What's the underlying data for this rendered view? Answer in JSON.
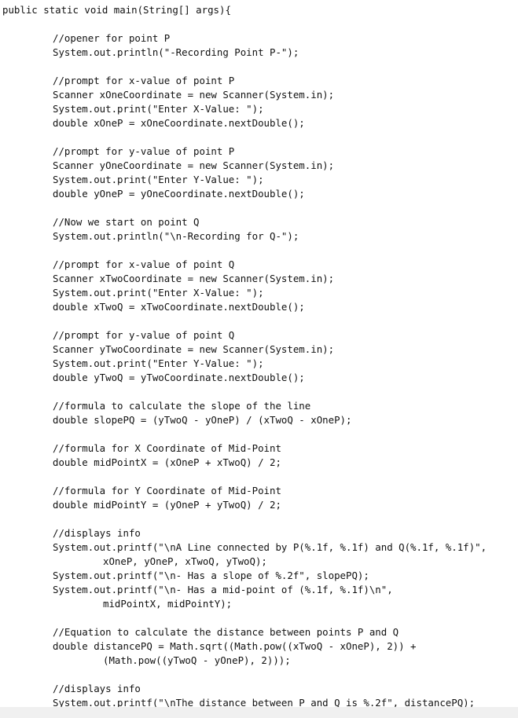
{
  "code": {
    "lines": [
      {
        "indent": 0,
        "text": "public static void main(String[] args){"
      },
      {
        "indent": 0,
        "text": ""
      },
      {
        "indent": 1,
        "text": "//opener for point P"
      },
      {
        "indent": 1,
        "text": "System.out.println(\"-Recording Point P-\");"
      },
      {
        "indent": 0,
        "text": ""
      },
      {
        "indent": 1,
        "text": "//prompt for x-value of point P"
      },
      {
        "indent": 1,
        "text": "Scanner xOneCoordinate = new Scanner(System.in);"
      },
      {
        "indent": 1,
        "text": "System.out.print(\"Enter X-Value: \");"
      },
      {
        "indent": 1,
        "text": "double xOneP = xOneCoordinate.nextDouble();"
      },
      {
        "indent": 0,
        "text": ""
      },
      {
        "indent": 1,
        "text": "//prompt for y-value of point P"
      },
      {
        "indent": 1,
        "text": "Scanner yOneCoordinate = new Scanner(System.in);"
      },
      {
        "indent": 1,
        "text": "System.out.print(\"Enter Y-Value: \");"
      },
      {
        "indent": 1,
        "text": "double yOneP = yOneCoordinate.nextDouble();"
      },
      {
        "indent": 0,
        "text": ""
      },
      {
        "indent": 1,
        "text": "//Now we start on point Q"
      },
      {
        "indent": 1,
        "text": "System.out.println(\"\\n-Recording for Q-\");"
      },
      {
        "indent": 0,
        "text": ""
      },
      {
        "indent": 1,
        "text": "//prompt for x-value of point Q"
      },
      {
        "indent": 1,
        "text": "Scanner xTwoCoordinate = new Scanner(System.in);"
      },
      {
        "indent": 1,
        "text": "System.out.print(\"Enter X-Value: \");"
      },
      {
        "indent": 1,
        "text": "double xTwoQ = xTwoCoordinate.nextDouble();"
      },
      {
        "indent": 0,
        "text": ""
      },
      {
        "indent": 1,
        "text": "//prompt for y-value of point Q"
      },
      {
        "indent": 1,
        "text": "Scanner yTwoCoordinate = new Scanner(System.in);"
      },
      {
        "indent": 1,
        "text": "System.out.print(\"Enter Y-Value: \");"
      },
      {
        "indent": 1,
        "text": "double yTwoQ = yTwoCoordinate.nextDouble();"
      },
      {
        "indent": 0,
        "text": ""
      },
      {
        "indent": 1,
        "text": "//formula to calculate the slope of the line"
      },
      {
        "indent": 1,
        "text": "double slopePQ = (yTwoQ - yOneP) / (xTwoQ - xOneP);"
      },
      {
        "indent": 0,
        "text": ""
      },
      {
        "indent": 1,
        "text": "//formula for X Coordinate of Mid-Point"
      },
      {
        "indent": 1,
        "text": "double midPointX = (xOneP + xTwoQ) / 2;"
      },
      {
        "indent": 0,
        "text": ""
      },
      {
        "indent": 1,
        "text": "//formula for Y Coordinate of Mid-Point"
      },
      {
        "indent": 1,
        "text": "double midPointY = (yOneP + yTwoQ) / 2;"
      },
      {
        "indent": 0,
        "text": ""
      },
      {
        "indent": 1,
        "text": "//displays info"
      },
      {
        "indent": 1,
        "text": "System.out.printf(\"\\nA Line connected by P(%.1f, %.1f) and Q(%.1f, %.1f)\","
      },
      {
        "indent": 2,
        "text": "xOneP, yOneP, xTwoQ, yTwoQ);"
      },
      {
        "indent": 1,
        "text": "System.out.printf(\"\\n- Has a slope of %.2f\", slopePQ);"
      },
      {
        "indent": 1,
        "text": "System.out.printf(\"\\n- Has a mid-point of (%.1f, %.1f)\\n\","
      },
      {
        "indent": 2,
        "text": "midPointX, midPointY);"
      },
      {
        "indent": 0,
        "text": ""
      },
      {
        "indent": 1,
        "text": "//Equation to calculate the distance between points P and Q"
      },
      {
        "indent": 1,
        "text": "double distancePQ = Math.sqrt((Math.pow((xTwoQ - xOneP), 2)) +"
      },
      {
        "indent": 2,
        "text": "(Math.pow((yTwoQ - yOneP), 2)));"
      },
      {
        "indent": 0,
        "text": ""
      },
      {
        "indent": 1,
        "text": "//displays info"
      },
      {
        "indent": 1,
        "text": "System.out.printf(\"\\nThe distance between P and Q is %.2f\", distancePQ);"
      }
    ]
  }
}
